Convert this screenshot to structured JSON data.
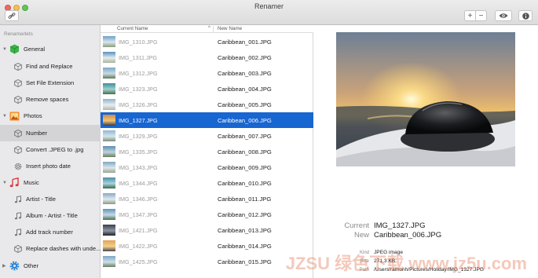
{
  "window": {
    "title": "Renamer"
  },
  "toolbar": {
    "add_label": "+",
    "remove_label": "−"
  },
  "sidebar": {
    "header": "Renamerlets",
    "groups": [
      {
        "label": "General",
        "icon": "cube-green-icon"
      },
      {
        "label": "Photos",
        "icon": "photo-icon"
      },
      {
        "label": "Music",
        "icon": "music-note-icon"
      },
      {
        "label": "Other",
        "icon": "gear-blue-icon"
      }
    ],
    "items": [
      {
        "label": "Find and Replace",
        "icon": "cube-gray-icon"
      },
      {
        "label": "Set File Extension",
        "icon": "cube-gray-icon"
      },
      {
        "label": "Remove spaces",
        "icon": "cube-gray-icon"
      },
      {
        "label": "Number",
        "icon": "cube-gray-icon"
      },
      {
        "label": "Convert .JPEG to .jpg",
        "icon": "cube-gray-icon"
      },
      {
        "label": "Insert photo date",
        "icon": "gear-gray-icon"
      },
      {
        "label": "Artist - Title",
        "icon": "music-note-gray-icon"
      },
      {
        "label": "Album - Artist - Title",
        "icon": "music-note-gray-icon"
      },
      {
        "label": "Add track number",
        "icon": "music-note-gray-icon"
      },
      {
        "label": "Replace dashes with unde...",
        "icon": "cube-gray-icon"
      }
    ],
    "selected": "Number"
  },
  "list": {
    "col_current": "Current Name",
    "col_new": "New Name",
    "sort_glyph": "^",
    "rows": [
      {
        "current": "IMG_1310.JPG",
        "new": "Caribbean_001.JPG"
      },
      {
        "current": "IMG_1311.JPG",
        "new": "Caribbean_002.JPG"
      },
      {
        "current": "IMG_1312.JPG",
        "new": "Caribbean_003.JPG"
      },
      {
        "current": "IMG_1323.JPG",
        "new": "Caribbean_004.JPG"
      },
      {
        "current": "IMG_1326.JPG",
        "new": "Caribbean_005.JPG"
      },
      {
        "current": "IMG_1327.JPG",
        "new": "Caribbean_006.JPG"
      },
      {
        "current": "IMG_1329.JPG",
        "new": "Caribbean_007.JPG"
      },
      {
        "current": "IMG_1335.JPG",
        "new": "Caribbean_008.JPG"
      },
      {
        "current": "IMG_1343.JPG",
        "new": "Caribbean_009.JPG"
      },
      {
        "current": "IMG_1344.JPG",
        "new": "Caribbean_010.JPG"
      },
      {
        "current": "IMG_1346.JPG",
        "new": "Caribbean_011.JPG"
      },
      {
        "current": "IMG_1347.JPG",
        "new": "Caribbean_012.JPG"
      },
      {
        "current": "IMG_1421.JPG",
        "new": "Caribbean_013.JPG"
      },
      {
        "current": "IMG_1422.JPG",
        "new": "Caribbean_014.JPG"
      },
      {
        "current": "IMG_1425.JPG",
        "new": "Caribbean_015.JPG"
      }
    ],
    "selected_index": 5
  },
  "preview": {
    "current_label": "Current",
    "current_value": "IMG_1327.JPG",
    "new_label": "New",
    "new_value": "Caribbean_006.JPG",
    "kind_label": "Kind",
    "kind_value": "JPEG image",
    "size_label": "Size",
    "size_value": "271,3 KB",
    "path_label": "Path",
    "path_value": "/Users/ramonh/Pictures/Holiday/IMG_1327.JPG"
  },
  "colors": {
    "selection": "#1766d1",
    "sidebar_bg": "#e9e8ea"
  },
  "watermark": "JZSU 绿色下载 www.jz5u.com"
}
